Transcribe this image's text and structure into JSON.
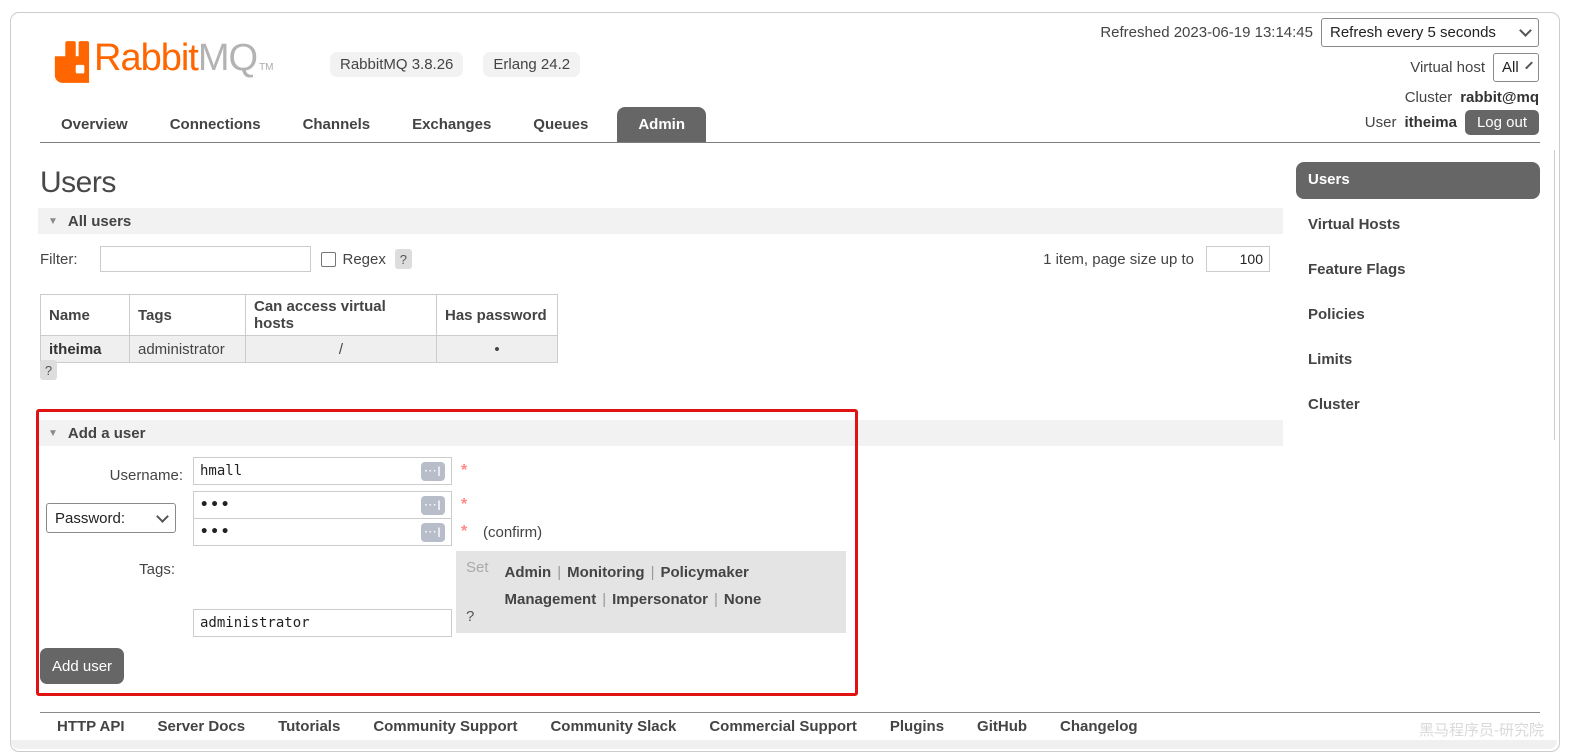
{
  "icons": {
    "collapse_triangle": "▼",
    "help": "?",
    "input_suggest": "···|",
    "bullet": "•"
  },
  "colors": {
    "accent_orange": "#ff6600",
    "dark_gray": "#666666",
    "annotation_red": "#e01212",
    "strip_bg": "#f2f2f2",
    "required_red": "#ff8888"
  },
  "header": {
    "logo": {
      "brand_orange": "Rabbit",
      "brand_gray": "MQ",
      "tm": "TM"
    },
    "badges": [
      {
        "label": "RabbitMQ 3.8.26"
      },
      {
        "label": "Erlang 24.2"
      }
    ],
    "refreshed_text": "Refreshed 2023-06-19 13:14:45",
    "refresh_select_value": "Refresh every 5 seconds",
    "virtual_host_label": "Virtual host",
    "virtual_host_value": "All",
    "cluster_label": "Cluster",
    "cluster_value": "rabbit@mq",
    "user_label": "User",
    "user_value": "itheima",
    "logout_label": "Log out"
  },
  "tabs": {
    "items": [
      {
        "label": "Overview"
      },
      {
        "label": "Connections"
      },
      {
        "label": "Channels"
      },
      {
        "label": "Exchanges"
      },
      {
        "label": "Queues"
      },
      {
        "label": "Admin",
        "active": true
      }
    ]
  },
  "page": {
    "title": "Users"
  },
  "all_users": {
    "section_title": "All users",
    "filter_label": "Filter:",
    "filter_value": "",
    "regex_label": "Regex",
    "help": "?",
    "pagination_text": "1 item, page size up to",
    "page_size_value": "100",
    "table": {
      "headers": [
        "Name",
        "Tags",
        "Can access virtual hosts",
        "Has password"
      ],
      "rows": [
        {
          "name": "itheima",
          "tags": "administrator",
          "vhosts": "/",
          "has_password": "•"
        }
      ]
    },
    "table_help": "?"
  },
  "add_user": {
    "section_title": "Add a user",
    "username_label": "Username:",
    "username_value": "hmall",
    "password_select_value": "Password:",
    "password_masked": "•••",
    "password_confirm_masked": "•••",
    "required_marker": "*",
    "confirm_note": "(confirm)",
    "tags_label": "Tags:",
    "set_label": "Set",
    "tag_options": [
      "Admin",
      "Monitoring",
      "Policymaker",
      "Management",
      "Impersonator",
      "None"
    ],
    "tag_separator": "|",
    "tags_value": "administrator",
    "tags_help": "?",
    "submit_label": "Add user"
  },
  "sidebar": {
    "items": [
      {
        "label": "Users",
        "active": true
      },
      {
        "label": "Virtual Hosts"
      },
      {
        "label": "Feature Flags"
      },
      {
        "label": "Policies"
      },
      {
        "label": "Limits"
      },
      {
        "label": "Cluster"
      }
    ]
  },
  "footer": {
    "links": [
      {
        "label": "HTTP API"
      },
      {
        "label": "Server Docs"
      },
      {
        "label": "Tutorials"
      },
      {
        "label": "Community Support"
      },
      {
        "label": "Community Slack"
      },
      {
        "label": "Commercial Support"
      },
      {
        "label": "Plugins"
      },
      {
        "label": "GitHub"
      },
      {
        "label": "Changelog"
      }
    ],
    "watermark": "黑马程序员-研究院"
  }
}
